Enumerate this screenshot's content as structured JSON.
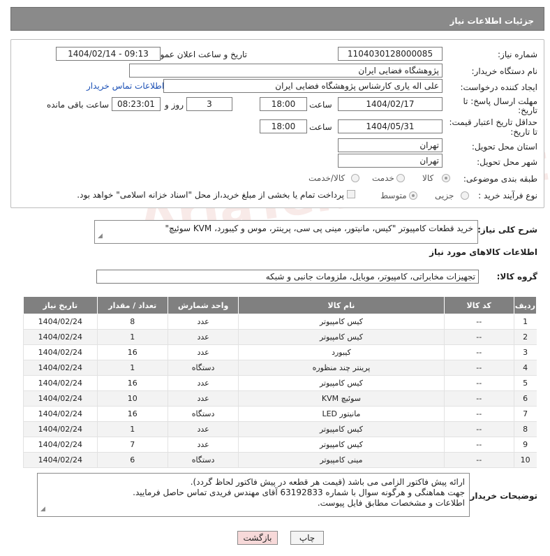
{
  "header": {
    "title": "جزئیات اطلاعات نیاز"
  },
  "form": {
    "need_number": {
      "label": "شماره نیاز:",
      "value": "1104030128000085"
    },
    "announce_datetime": {
      "label": "تاریخ و ساعت اعلان عمومی:",
      "value": "1404/02/14 - 09:13"
    },
    "buyer_org": {
      "label": "نام دستگاه خریدار:",
      "value": "پژوهشگاه فضایی ایران"
    },
    "creator": {
      "label": "ایجاد کننده درخواست:",
      "value": "علی اله یاری کارشناس پژوهشگاه فضایی ایران",
      "contact_link": "اطلاعات تماس خریدار"
    },
    "reply_deadline": {
      "label_line1": "مهلت ارسال پاسخ: تا",
      "label_line2": "تاریخ:",
      "date": "1404/02/17",
      "time_label": "ساعت",
      "time": "18:00",
      "days": "3",
      "days_label": "روز و",
      "remaining": "08:23:01",
      "remaining_label": "ساعت باقی مانده"
    },
    "price_validity": {
      "label_line1": "حداقل تاریخ اعتبار قیمت:",
      "label_line2": "تا تاریخ:",
      "date": "1404/05/31",
      "time_label": "ساعت",
      "time": "18:00"
    },
    "delivery_province": {
      "label": "استان محل تحویل:",
      "value": "تهران"
    },
    "delivery_city": {
      "label": "شهر محل تحویل:",
      "value": "تهران"
    },
    "category": {
      "label": "طبقه بندی موضوعی:",
      "options": [
        "کالا",
        "خدمت",
        "کالا/خدمت"
      ],
      "selected": "کالا"
    },
    "process_type": {
      "label": "نوع فرآیند خرید :",
      "options": [
        "جزیی",
        "متوسط"
      ],
      "selected": "متوسط",
      "payment_note": "پرداخت تمام یا بخشی از مبلغ خرید،از محل \"اسناد خزانه اسلامی\" خواهد بود."
    }
  },
  "description": {
    "label": "شرح کلی نیاز:",
    "value": "خرید قطعات کامپیوتر \"کیس، مانیتور، مینی پی سی، پرینتر، موس و کیبورد، KVM سوئیچ\""
  },
  "goods_section": {
    "title": "اطلاعات کالاهای مورد نیاز",
    "group_label": "گروه کالا:",
    "group_value": "تجهیزات مخابراتی، کامپیوتر، موبایل، ملزومات جانبی و شبکه"
  },
  "table": {
    "headers": [
      "ردیف",
      "کد کالا",
      "نام کالا",
      "واحد شمارش",
      "تعداد / مقدار",
      "تاریخ نیاز"
    ],
    "rows": [
      [
        "1",
        "--",
        "کیس کامپیوتر",
        "عدد",
        "8",
        "1404/02/24"
      ],
      [
        "2",
        "--",
        "کیس کامپیوتر",
        "عدد",
        "1",
        "1404/02/24"
      ],
      [
        "3",
        "--",
        "کیبورد",
        "عدد",
        "16",
        "1404/02/24"
      ],
      [
        "4",
        "--",
        "پرینتر چند منظوره",
        "دستگاه",
        "1",
        "1404/02/24"
      ],
      [
        "5",
        "--",
        "کیس کامپیوتر",
        "عدد",
        "16",
        "1404/02/24"
      ],
      [
        "6",
        "--",
        "سوئیچ KVM",
        "عدد",
        "10",
        "1404/02/24"
      ],
      [
        "7",
        "--",
        "مانیتور LED",
        "دستگاه",
        "16",
        "1404/02/24"
      ],
      [
        "8",
        "--",
        "کیس کامپیوتر",
        "عدد",
        "1",
        "1404/02/24"
      ],
      [
        "9",
        "--",
        "کیس کامپیوتر",
        "عدد",
        "7",
        "1404/02/24"
      ],
      [
        "10",
        "--",
        "مینی کامپیوتر",
        "دستگاه",
        "6",
        "1404/02/24"
      ]
    ]
  },
  "buyer_notes": {
    "label": "توضیحات خریدار:",
    "lines": [
      "ارائه پیش فاکتور الزامی می باشد (قیمت هر قطعه در پیش فاکتور لحاظ گردد).",
      "جهت هماهنگی و هرگونه سوال با شماره 63192833 آقای مهندس فریدی تماس حاصل فرمایید.",
      "اطلاعات و مشخصات مطابق فایل پیوست."
    ]
  },
  "buttons": {
    "print": "چاپ",
    "back": "بازگشت"
  }
}
